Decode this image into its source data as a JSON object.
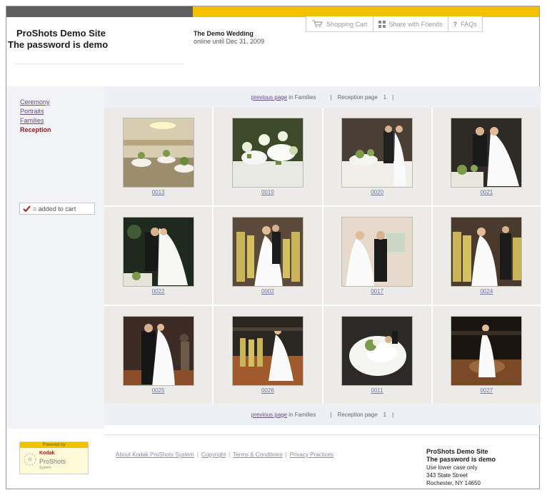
{
  "header": {
    "site_title": "ProShots Demo Site",
    "site_subtitle": "The password is demo",
    "event_title": "The Demo Wedding",
    "event_subtitle": "online until Dec 31, 2009"
  },
  "topnav": {
    "cart_label": "Shopping Cart",
    "share_label": "Share with Friends",
    "faq_label": "FAQs"
  },
  "sidebar": {
    "items": [
      {
        "label": "Ceremony",
        "active": false
      },
      {
        "label": "Portraits",
        "active": false
      },
      {
        "label": "Families",
        "active": false
      },
      {
        "label": "Reception",
        "active": true
      }
    ],
    "legend_label": "= added to cart"
  },
  "pager": {
    "prev_link": "previous page",
    "prev_suffix": "in Families",
    "page_sep_left": "|",
    "page_label": "Reception page",
    "page_number": "1",
    "page_sep_right": "|"
  },
  "photos": [
    {
      "code": "0013",
      "scene": "hall"
    },
    {
      "code": "0019",
      "scene": "cake"
    },
    {
      "code": "0020",
      "scene": "cutting"
    },
    {
      "code": "0021",
      "scene": "cutting2"
    },
    {
      "code": "0022",
      "scene": "kiss"
    },
    {
      "code": "0002",
      "scene": "entrance"
    },
    {
      "code": "0017",
      "scene": "couple"
    },
    {
      "code": "0024",
      "scene": "bridesmaids"
    },
    {
      "code": "0025",
      "scene": "dance"
    },
    {
      "code": "0026",
      "scene": "floor"
    },
    {
      "code": "0011",
      "scene": "gown"
    },
    {
      "code": "0027",
      "scene": "spotlight"
    }
  ],
  "footer": {
    "badge_powered": "Powered by",
    "badge_brand": "Kodak",
    "badge_name": "ProShots",
    "badge_system": "System",
    "links": [
      "About Kodak ProShots System",
      "Copyright",
      "Terms & Conditions",
      "Privacy Practices"
    ],
    "link_separator": "|",
    "contact": {
      "name": "ProShots Demo Site",
      "password_note": "The password is demo",
      "case_note": "Use lower case only",
      "street": "343 State Street",
      "city": "Rochester, NY 14650"
    }
  },
  "colors": {
    "top_bar_dark": "#5f5f5f",
    "top_bar_accent": "#f2c200",
    "active_nav": "#a0191c",
    "link": "#6a4a8a"
  }
}
